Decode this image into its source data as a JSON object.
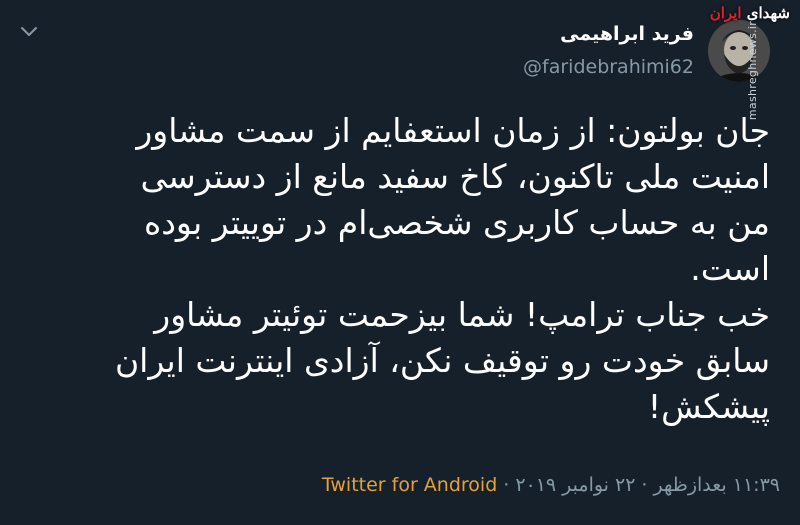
{
  "tweet": {
    "author": {
      "display_name": "فرید ابراهیمی",
      "handle": "@faridebrahimi62"
    },
    "text": "جان بولتون: از زمان استعفایم از سمت مشاور\nامنیت ملی تاکنون، کاخ سفید مانع از دسترسی\nمن به حساب کاربری شخصی‌ام در توییتر بوده\nاست.\nخب جناب ترامپ! شما بیزحمت توئیتر مشاور\nسابق خودت رو توقیف نکن، آزادی اینترنت ایران\nپیشکش!",
    "time": "۱۱:۳۹ بعدازظهر",
    "date": "۲۲ نوامبر ۲۰۱۹",
    "separator": "·",
    "source": "Twitter for Android"
  },
  "watermark": {
    "logo_text": "شهدای ایران",
    "site": "mashreghnews.ir"
  },
  "icons": {
    "menu": "chevron-down-icon",
    "avatar": "profile-photo"
  },
  "colors": {
    "background": "#15202b",
    "secondary_text": "#8899a6",
    "source_link": "#e2a23b"
  }
}
